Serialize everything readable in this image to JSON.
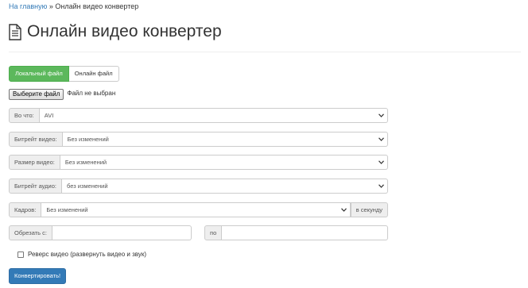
{
  "breadcrumb": {
    "home_link": "На главную",
    "separator": "»",
    "current": "Онлайн видео конвертер"
  },
  "header": {
    "title": "Онлайн видео конвертер",
    "icon": "document-icon"
  },
  "tabs": [
    {
      "label": "Локальный файл",
      "active": true
    },
    {
      "label": "Онлайн файл",
      "active": false
    }
  ],
  "file_picker": {
    "button_label": "Выберите файл",
    "status": "Файл не выбран"
  },
  "form": {
    "format": {
      "label": "Во что:",
      "value": "AVI"
    },
    "video_bitrate": {
      "label": "Битрейт видео:",
      "value": "Без изменений"
    },
    "video_size": {
      "label": "Размер видео:",
      "value": "Без изменений"
    },
    "audio_bitrate": {
      "label": "Битрейт аудио:",
      "value": "без изменений"
    },
    "frames": {
      "label": "Кадров:",
      "value": "Без изменений",
      "suffix": "в секунду"
    },
    "trim": {
      "from_label": "Обрезать с:",
      "from_value": "",
      "to_label": "по",
      "to_value": ""
    },
    "reverse": {
      "label": "Реверс видео (развернуть видео и звук)",
      "checked": false
    },
    "submit_label": "Конвертировать!"
  },
  "colors": {
    "link": "#337ab7",
    "active_tab": "#5cb85c",
    "primary_button": "#337ab7",
    "addon_bg": "#eeeeee",
    "border": "#cccccc"
  }
}
